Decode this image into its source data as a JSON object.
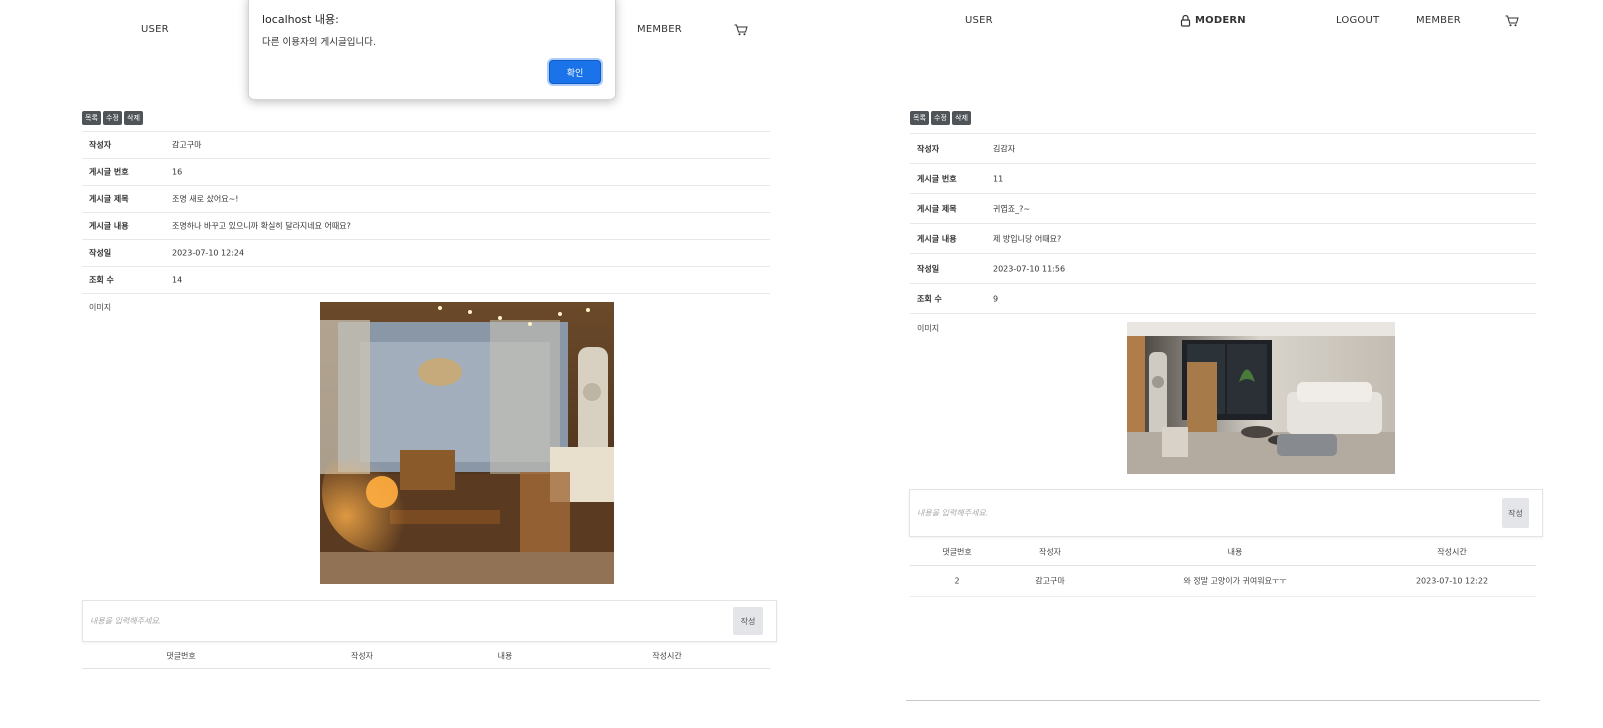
{
  "left": {
    "nav": {
      "user": "USER",
      "member": "MEMBER"
    },
    "action_buttons": [
      "목록",
      "수정",
      "삭제"
    ],
    "details": [
      {
        "label": "작성자",
        "value": "감고구마"
      },
      {
        "label": "게시글 번호",
        "value": "16"
      },
      {
        "label": "게시글 제목",
        "value": "조명 새로 샀어요~!"
      },
      {
        "label": "게시글 내용",
        "value": "조명하나 바꾸고 있으니까 확실히 달라지네요 어때요?"
      },
      {
        "label": "작성일",
        "value": "2023-07-10 12:24"
      },
      {
        "label": "조회 수",
        "value": "14"
      }
    ],
    "image_label": "이미지",
    "comment": {
      "placeholder": "내용을 입력해주세요.",
      "submit": "작성"
    },
    "columns": [
      "댓글번호",
      "작성자",
      "내용",
      "작성시간"
    ],
    "rows": []
  },
  "dialog": {
    "title": "localhost 내용:",
    "message": "다른 이용자의 게시글입니다.",
    "ok": "확인"
  },
  "right": {
    "nav": {
      "user": "USER",
      "brand": "MODERN",
      "logout": "LOGOUT",
      "member": "MEMBER"
    },
    "action_buttons": [
      "목록",
      "수정",
      "삭제"
    ],
    "details": [
      {
        "label": "작성자",
        "value": "김감자"
      },
      {
        "label": "게시글 번호",
        "value": "11"
      },
      {
        "label": "게시글 제목",
        "value": "귀엽죠_?~"
      },
      {
        "label": "게시글 내용",
        "value": "제 방입니당 어때요?"
      },
      {
        "label": "작성일",
        "value": "2023-07-10 11:56"
      },
      {
        "label": "조회 수",
        "value": "9"
      }
    ],
    "image_label": "이미지",
    "comment": {
      "placeholder": "내용을 입력해주세요.",
      "submit": "작성"
    },
    "columns": [
      "댓글번호",
      "작성자",
      "내용",
      "작성시간"
    ],
    "rows": [
      {
        "no": "2",
        "author": "감고구마",
        "content": "와 정말 고양이가 귀여워요ㅜㅜ",
        "time": "2023-07-10 12:22"
      }
    ]
  },
  "icons": {
    "cart": "cart-icon",
    "lock": "lock-icon"
  }
}
